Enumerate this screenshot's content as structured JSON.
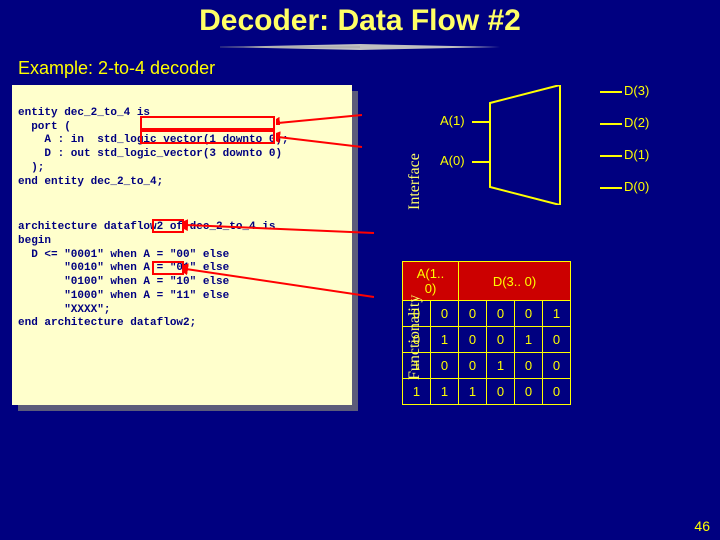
{
  "title": "Decoder: Data Flow #2",
  "subtitle": "Example: 2-to-4 decoder",
  "code_entity": "entity dec_2_to_4 is\n  port (\n    A : in  std_logic_vector(1 downto 0);\n    D : out std_logic_vector(3 downto 0)\n  );\nend entity dec_2_to_4;",
  "code_arch": "architecture dataflow2 of dec_2_to_4 is\nbegin\n  D <= \"0001\" when A = \"00\" else\n       \"0010\" when A = \"01\" else\n       \"0100\" when A = \"10\" else\n       \"1000\" when A = \"11\" else\n       \"XXXX\";\nend architecture dataflow2;",
  "side_labels": {
    "interface": "Interface",
    "functionality": "Functionality"
  },
  "mux": {
    "inputs": [
      "A(1)",
      "A(0)"
    ],
    "outputs": [
      "D(3)",
      "D(2)",
      "D(1)",
      "D(0)"
    ]
  },
  "truth_table": {
    "header_left": "A(1.. 0)",
    "header_right": "D(3.. 0)",
    "rows": [
      {
        "a": [
          "0",
          "0"
        ],
        "d": [
          "0",
          "0",
          "0",
          "1"
        ]
      },
      {
        "a": [
          "0",
          "1"
        ],
        "d": [
          "0",
          "0",
          "1",
          "0"
        ]
      },
      {
        "a": [
          "1",
          "0"
        ],
        "d": [
          "0",
          "1",
          "0",
          "0"
        ]
      },
      {
        "a": [
          "1",
          "1"
        ],
        "d": [
          "1",
          "0",
          "0",
          "0"
        ]
      }
    ]
  },
  "page_number": "46"
}
